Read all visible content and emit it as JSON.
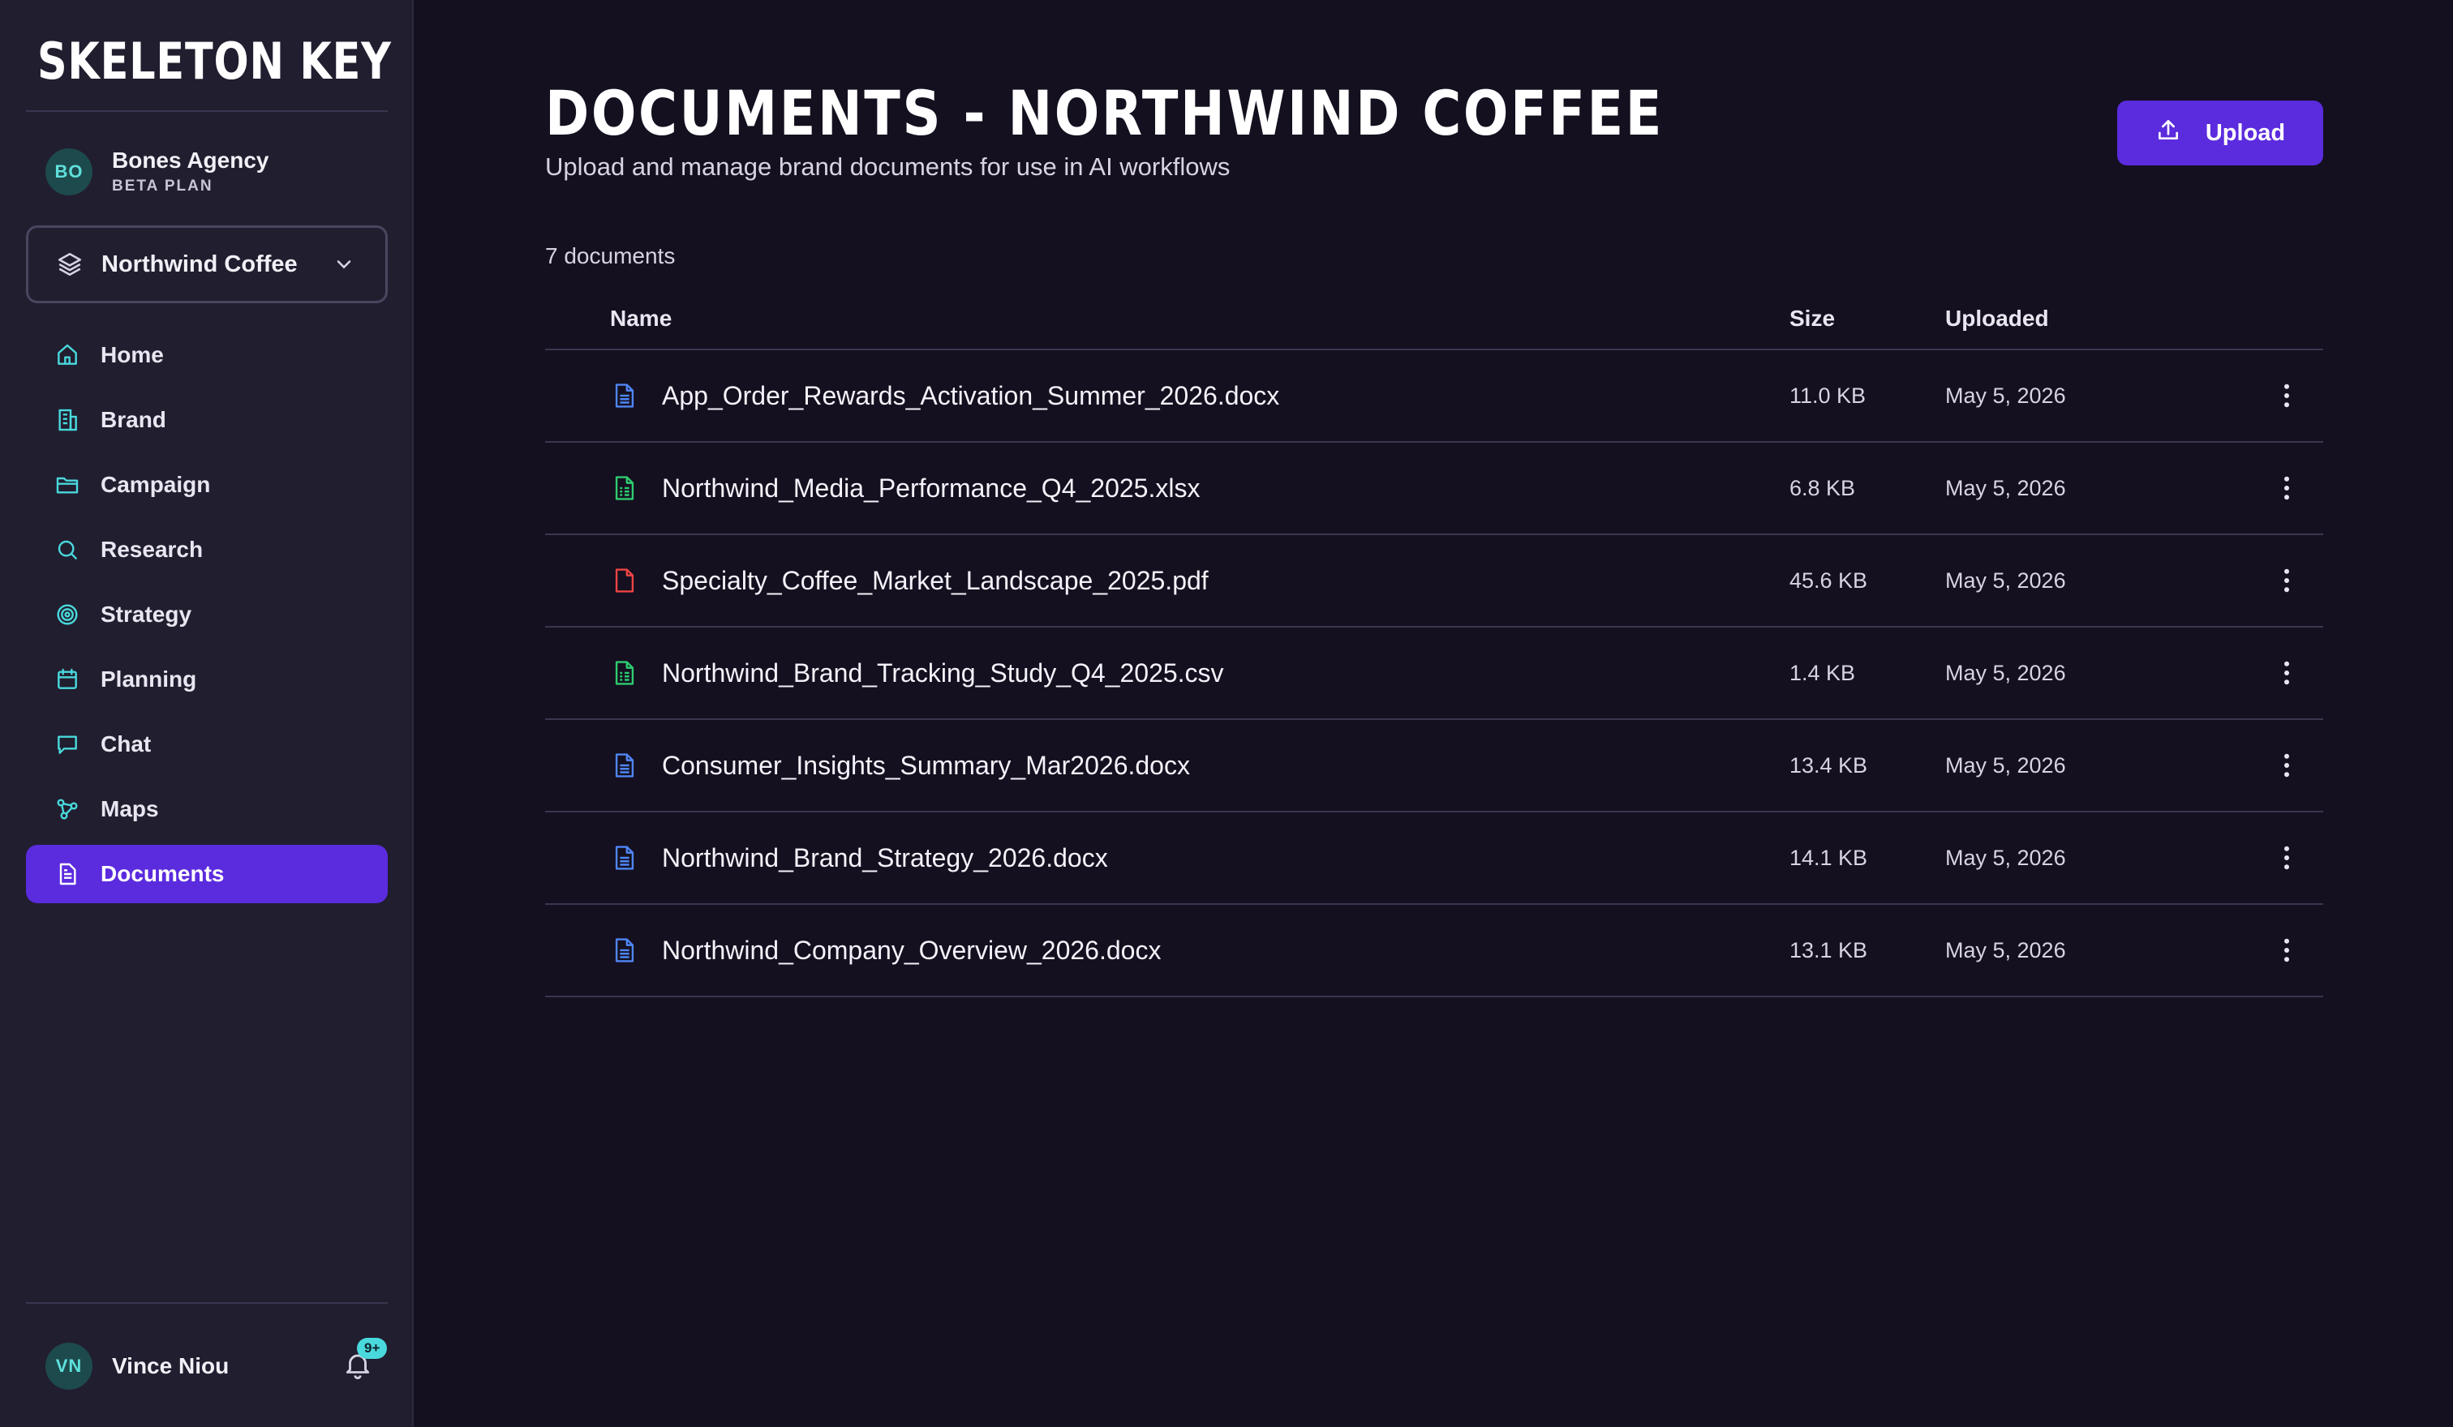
{
  "sidebar": {
    "logo_text": "SKELETON KEY",
    "agency": {
      "initials": "BO",
      "name": "Bones Agency",
      "plan": "BETA PLAN"
    },
    "workspace": {
      "name": "Northwind Coffee"
    },
    "nav": [
      {
        "label": "Home",
        "icon": "home-icon",
        "active": false
      },
      {
        "label": "Brand",
        "icon": "building-icon",
        "active": false
      },
      {
        "label": "Campaign",
        "icon": "folder-icon",
        "active": false
      },
      {
        "label": "Research",
        "icon": "search-icon",
        "active": false
      },
      {
        "label": "Strategy",
        "icon": "target-icon",
        "active": false
      },
      {
        "label": "Planning",
        "icon": "calendar-icon",
        "active": false
      },
      {
        "label": "Chat",
        "icon": "chat-icon",
        "active": false
      },
      {
        "label": "Maps",
        "icon": "map-nodes-icon",
        "active": false
      },
      {
        "label": "Documents",
        "icon": "document-icon",
        "active": true
      }
    ],
    "user": {
      "initials": "VN",
      "name": "Vince Niou",
      "notifications": "9+"
    }
  },
  "header": {
    "title": "DOCUMENTS - NORTHWIND COFFEE",
    "subtitle": "Upload and manage brand documents for use in AI workflows",
    "upload_label": "Upload"
  },
  "documents": {
    "count_label": "7 documents",
    "columns": {
      "name": "Name",
      "size": "Size",
      "uploaded": "Uploaded"
    },
    "rows": [
      {
        "name": "App_Order_Rewards_Activation_Summer_2026.docx",
        "size": "11.0 KB",
        "uploaded": "May 5, 2026",
        "type": "doc"
      },
      {
        "name": "Northwind_Media_Performance_Q4_2025.xlsx",
        "size": "6.8 KB",
        "uploaded": "May 5, 2026",
        "type": "sheet"
      },
      {
        "name": "Specialty_Coffee_Market_Landscape_2025.pdf",
        "size": "45.6 KB",
        "uploaded": "May 5, 2026",
        "type": "pdf"
      },
      {
        "name": "Northwind_Brand_Tracking_Study_Q4_2025.csv",
        "size": "1.4 KB",
        "uploaded": "May 5, 2026",
        "type": "sheet"
      },
      {
        "name": "Consumer_Insights_Summary_Mar2026.docx",
        "size": "13.4 KB",
        "uploaded": "May 5, 2026",
        "type": "doc"
      },
      {
        "name": "Northwind_Brand_Strategy_2026.docx",
        "size": "14.1 KB",
        "uploaded": "May 5, 2026",
        "type": "doc"
      },
      {
        "name": "Northwind_Company_Overview_2026.docx",
        "size": "13.1 KB",
        "uploaded": "May 5, 2026",
        "type": "doc"
      }
    ]
  },
  "colors": {
    "accent": "#5b2bde",
    "teal": "#49d9dd",
    "doc_icon": "#4f86f7",
    "sheet_icon": "#2ecc71",
    "pdf_icon": "#ef4444"
  }
}
